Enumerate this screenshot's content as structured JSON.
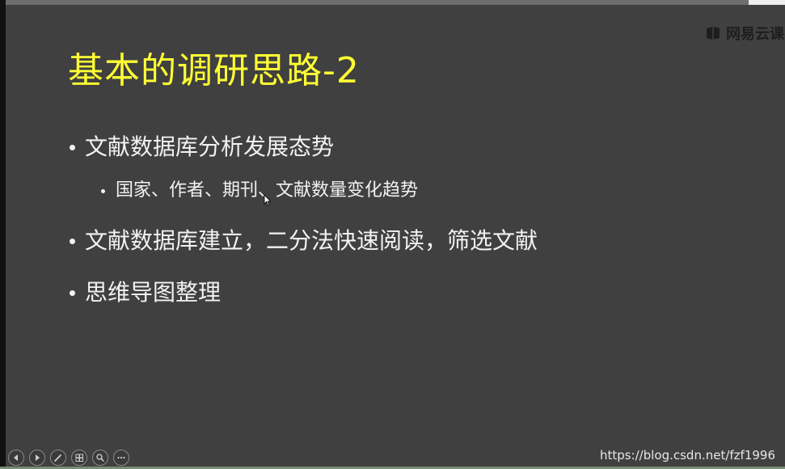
{
  "slide": {
    "title": "基本的调研思路-2",
    "bullets": [
      {
        "text": "文献数据库分析发展态势",
        "sub": [
          {
            "text": "国家、作者、期刊、文献数量变化趋势"
          }
        ]
      },
      {
        "text": "文献数据库建立，二分法快速阅读，筛选文献"
      },
      {
        "text": "思维导图整理"
      }
    ]
  },
  "watermark": {
    "text": "网易云课",
    "icon": "netease-cloud-class-logo-icon"
  },
  "footer": {
    "url": "https://blog.csdn.net/fzf1996"
  },
  "controls": [
    {
      "name": "previous-slide-button",
      "icon": "arrow-left-icon"
    },
    {
      "name": "next-slide-button",
      "icon": "arrow-right-icon"
    },
    {
      "name": "pen-tool-button",
      "icon": "pen-icon"
    },
    {
      "name": "slides-overview-button",
      "icon": "slides-icon"
    },
    {
      "name": "zoom-button",
      "icon": "magnifier-icon"
    },
    {
      "name": "more-options-button",
      "icon": "ellipsis-icon"
    }
  ],
  "colors": {
    "background": "#404040",
    "title": "#ffff33",
    "text": "#f2f2f2"
  }
}
